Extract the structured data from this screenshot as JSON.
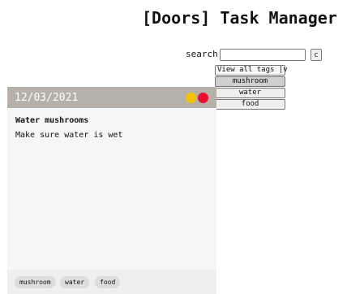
{
  "app": {
    "title": "[Doors] Task Manager"
  },
  "search": {
    "label": "search",
    "value": "",
    "placeholder": "",
    "clear_label": "c"
  },
  "tag_filter": {
    "toggle_label": "View all tags |v",
    "options": [
      {
        "label": "mushroom",
        "selected": true
      },
      {
        "label": "water",
        "selected": false
      },
      {
        "label": "food",
        "selected": false
      }
    ]
  },
  "task": {
    "date": "12/03/2021",
    "status_colors": [
      "#f5c400",
      "#e8102e"
    ],
    "title": "Water mushrooms",
    "description": "Make sure water is wet",
    "tags": [
      "mushroom",
      "water",
      "food"
    ]
  }
}
